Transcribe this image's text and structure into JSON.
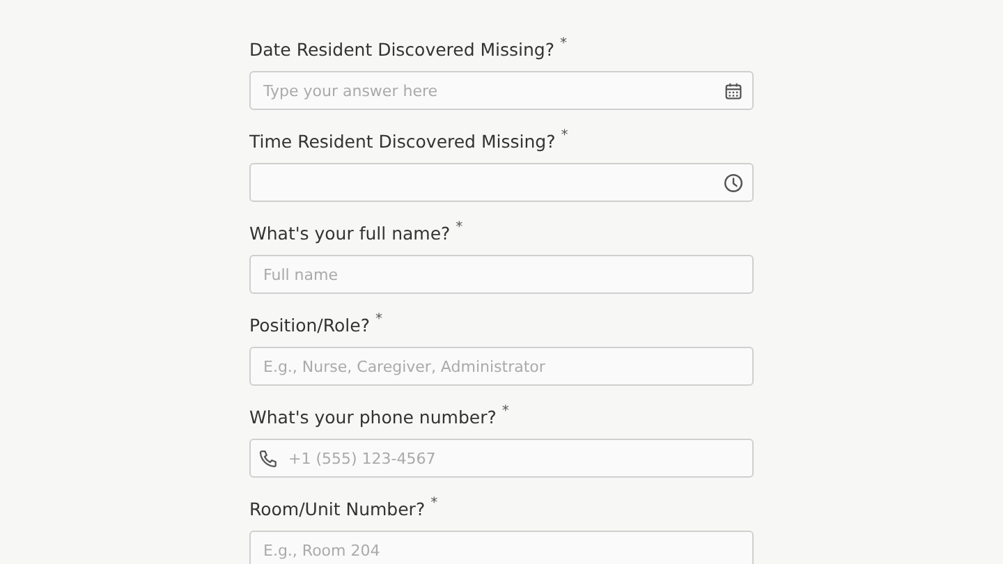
{
  "questions": [
    {
      "label": "Date Resident Discovered Missing?",
      "mark": "*",
      "kind": "date",
      "placeholder": "Type your answer here"
    },
    {
      "label": "Time Resident Discovered Missing?",
      "mark": "*",
      "kind": "time"
    },
    {
      "label": "What's your full name?",
      "mark": "*",
      "kind": "text",
      "placeholder": "Full name"
    },
    {
      "label": "Position/Role?",
      "mark": "*",
      "kind": "text",
      "placeholder": "E.g., Nurse, Caregiver, Administrator"
    },
    {
      "label": "What's your phone number?",
      "mark": "*",
      "kind": "phone",
      "placeholder": "+1 (555) 123-4567"
    },
    {
      "label": "Room/Unit Number?",
      "mark": "*",
      "kind": "text",
      "placeholder": "E.g., Room 204"
    }
  ]
}
